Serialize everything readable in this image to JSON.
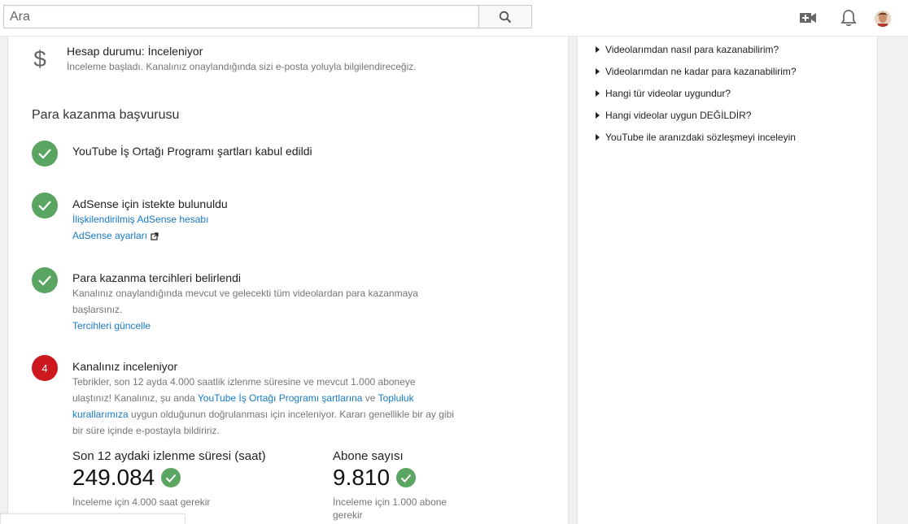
{
  "search": {
    "placeholder": "Ara"
  },
  "header": {
    "icons": [
      "search-icon",
      "video-camera-add-icon",
      "bell-icon",
      "avatar"
    ]
  },
  "account_status": {
    "icon": "dollar-icon",
    "title": "Hesap durumu: İnceleniyor",
    "description": "İnceleme başladı. Kanalınız onaylandığında sizi e-posta yoluyla bilgilendireceğiz."
  },
  "application": {
    "title": "Para kazanma başvurusu",
    "steps": [
      {
        "status": "done",
        "title": "YouTube İş Ortağı Programı şartları kabul edildi"
      },
      {
        "status": "done",
        "title": "AdSense için istekte bulunuldu",
        "link1": "İlişkilendirilmiş AdSense hesabı",
        "link2": "AdSense ayarları"
      },
      {
        "status": "done",
        "title": "Para kazanma tercihleri belirlendi",
        "text": "Kanalınız onaylandığında mevcut ve gelecekti tüm videolardan para kazanmaya başlarsınız.",
        "link": "Tercihleri güncelle"
      },
      {
        "status": "pending",
        "number": "4",
        "title": "Kanalınız inceleniyor",
        "text_part1": "Tebrikler, son 12 ayda 4.000 saatlik izlenme süresine ve mevcut 1.000 aboneye ulaştınız! Kanalınız, şu anda ",
        "link_partner": "YouTube İş Ortağı Programı şartlarına",
        "text_part2": " ve ",
        "link_community": "Topluluk kurallarımıza",
        "text_part3": " uygun olduğunun doğrulanması için inceleniyor. Kararı genellikle bir ay gibi bir süre içinde e-postayla bildiririz."
      }
    ]
  },
  "stats": {
    "watch_time": {
      "label": "Son 12 aydaki izlenme süresi (saat)",
      "value": "249.084",
      "note": "İnceleme için 4.000 saat gerekir"
    },
    "subscribers": {
      "label": "Abone sayısı",
      "value": "9.810",
      "note": "İnceleme için 1.000 abone gerekir"
    }
  },
  "sidebar": {
    "faq": [
      "Videolarımdan nasıl para kazanabilirim?",
      "Videolarımdan ne kadar para kazanabilirim?",
      "Hangi tür videolar uygundur?",
      "Hangi videolar uygun DEĞİLDİR?",
      "YouTube ile aranızdaki sözleşmeyi inceleyin"
    ]
  },
  "colors": {
    "check_green": "#5ba562",
    "pending_red": "#cc181e",
    "link_blue": "#167ac6"
  }
}
